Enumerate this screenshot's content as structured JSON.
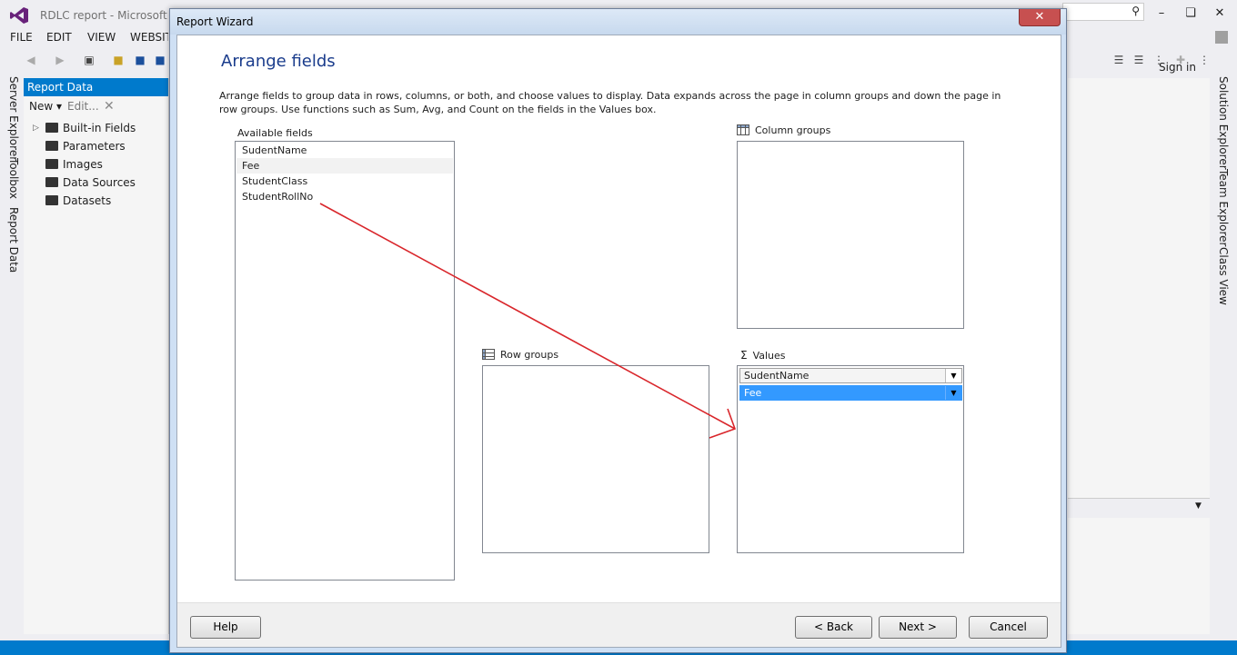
{
  "vs": {
    "window_title": "RDLC report - Microsoft Vi",
    "menu": [
      "FILE",
      "EDIT",
      "VIEW",
      "WEBSITE"
    ],
    "sign_in": "Sign in",
    "left_tabs": [
      "Server Explorer",
      "Toolbox",
      "Report Data"
    ],
    "right_tabs": [
      "Solution Explorer",
      "Team Explorer",
      "Class View"
    ]
  },
  "report_data": {
    "header": "Report Data",
    "new_label": "New",
    "edit_label": "Edit...",
    "tree": [
      "Built-in Fields",
      "Parameters",
      "Images",
      "Data Sources",
      "Datasets"
    ]
  },
  "wizard": {
    "title": "Report Wizard",
    "heading": "Arrange fields",
    "description": "Arrange fields to group data in rows, columns, or both, and choose values to display. Data expands across the page in column groups and down the page in row groups.  Use functions such as Sum, Avg, and Count on the fields in the Values box.",
    "available_label": "Available fields",
    "available_fields": [
      "SudentName",
      "Fee",
      "StudentClass",
      "StudentRollNo"
    ],
    "column_groups_label": "Column groups",
    "row_groups_label": "Row groups",
    "values_label": "Values",
    "values": [
      "SudentName",
      "Fee"
    ],
    "buttons": {
      "help": "Help",
      "back": "< Back",
      "next": "Next >",
      "cancel": "Cancel"
    }
  },
  "colors": {
    "accent": "#007acc",
    "heading": "#1a3c8c",
    "selection": "#3399ff",
    "annotation_arrow": "#d9262b"
  }
}
